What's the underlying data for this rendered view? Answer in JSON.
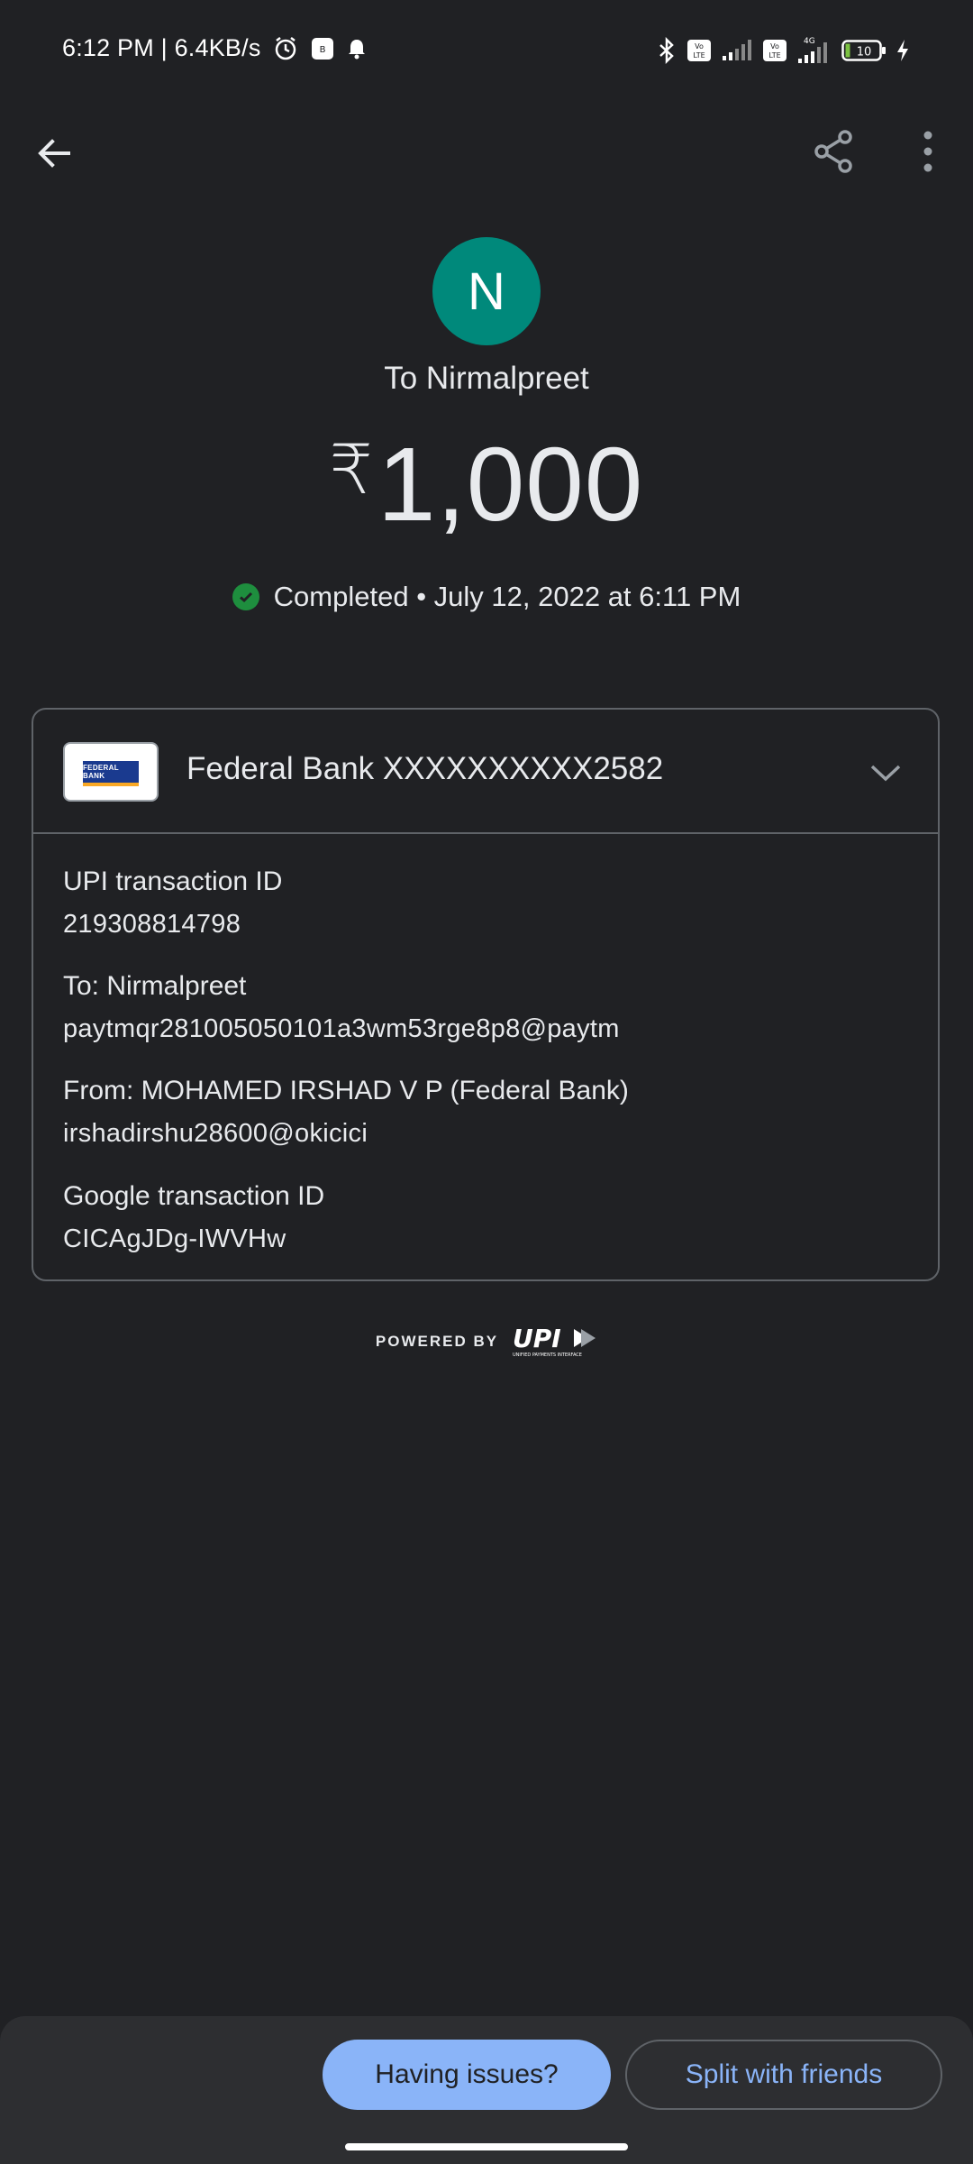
{
  "status_bar": {
    "time_speed": "6:12 PM | 6.4KB/s",
    "battery": "10",
    "network_label": "4G",
    "icons": [
      "alarm-icon",
      "app-notification-icon",
      "bell-icon",
      "bluetooth-icon",
      "volte-icon",
      "signal-icon",
      "volte-icon",
      "signal-icon",
      "battery-icon",
      "charging-icon"
    ]
  },
  "app_bar": {
    "back_icon": "arrow-back-icon",
    "share_icon": "share-icon",
    "more_icon": "more-vert-icon"
  },
  "recipient": {
    "avatar_initial": "N",
    "avatar_color": "#00897b",
    "title": "To Nirmalpreet"
  },
  "amount": {
    "currency": "₹",
    "value": "1,000"
  },
  "status": {
    "text": "Completed • July 12, 2022 at 6:11 PM",
    "color": "#1e8e3e"
  },
  "card": {
    "bank_logo_text": "FEDERAL BANK",
    "bank_account": "Federal Bank XXXXXXXXXX2582",
    "details": [
      {
        "label": "UPI transaction ID",
        "value": "219308814798"
      },
      {
        "label": "To: Nirmalpreet",
        "value": "paytmqr281005050101a3wm53rge8p8@paytm"
      },
      {
        "label": "From: MOHAMED IRSHAD V P (Federal Bank)",
        "value": "irshadirshu28600@okicici"
      },
      {
        "label": "Google transaction ID",
        "value": "CICAgJDg-IWVHw"
      }
    ]
  },
  "footer": {
    "powered_by": "POWERED BY",
    "upi_logo": "UPI",
    "upi_subtext": "UNIFIED PAYMENTS INTERFACE"
  },
  "actions": {
    "having_issues": "Having issues?",
    "split": "Split with friends",
    "accent": "#8ab4f8"
  }
}
